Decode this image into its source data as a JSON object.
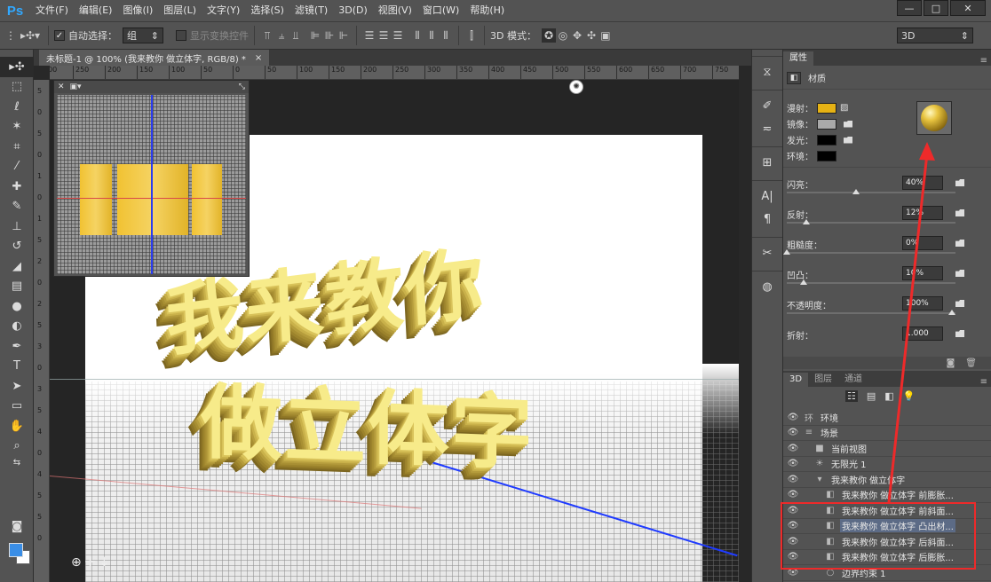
{
  "app": {
    "logo": "Ps",
    "menu": [
      "文件(F)",
      "编辑(E)",
      "图像(I)",
      "图层(L)",
      "文字(Y)",
      "选择(S)",
      "滤镜(T)",
      "3D(D)",
      "视图(V)",
      "窗口(W)",
      "帮助(H)"
    ],
    "window_controls": {
      "minimize": "—",
      "maximize": "□",
      "close": "✕"
    }
  },
  "options_bar": {
    "auto_select_label": "自动选择：",
    "auto_select_checked": true,
    "auto_select_value": "组",
    "show_transform_label": "显示变换控件",
    "mode_3d_label": "3D 模式：",
    "workspace_value": "3D"
  },
  "document": {
    "tab_title": "未标题-1 @ 100% (我来教你 做立体字, RGB/8) *",
    "ruler_top_ticks": [
      "300",
      "250",
      "200",
      "150",
      "100",
      "50",
      "0",
      "50",
      "100",
      "150",
      "200",
      "250",
      "300",
      "350",
      "400",
      "450",
      "500",
      "550",
      "600",
      "650",
      "700",
      "750"
    ],
    "ruler_left_digits": [
      "5",
      "0",
      "5",
      "0",
      "1",
      "0",
      "1",
      "5",
      "2",
      "0",
      "2",
      "5",
      "3",
      "0",
      "3",
      "5",
      "4",
      "0",
      "4",
      "5",
      "5",
      "0"
    ],
    "text_line1": "我来教你",
    "text_line2": "做立体字"
  },
  "properties_panel": {
    "tab": "属性",
    "section": "材质",
    "materials": [
      {
        "label": "漫射：",
        "color": "#e6b214"
      },
      {
        "label": "镜像：",
        "color": "#a9a9a9"
      },
      {
        "label": "发光：",
        "color": "#000000"
      },
      {
        "label": "环境：",
        "color": "#000000"
      }
    ],
    "sliders": [
      {
        "label": "闪亮：",
        "value": "40%",
        "level": 0.42
      },
      {
        "label": "反射：",
        "value": "12%",
        "level": 0.12
      },
      {
        "label": "粗糙度：",
        "value": "0%",
        "level": 0.0
      },
      {
        "label": "凹凸：",
        "value": "10%",
        "level": 0.1
      },
      {
        "label": "不透明度：",
        "value": "100%",
        "level": 1.0
      },
      {
        "label": "折射：",
        "value": "1.000",
        "level": null
      }
    ]
  },
  "layers_panel": {
    "tabs": [
      "3D",
      "图层",
      "通道"
    ],
    "rows": [
      {
        "name": "环境",
        "icon": "环",
        "indent": 0,
        "selected": false
      },
      {
        "name": "场景",
        "icon": "≡",
        "indent": 0,
        "selected": false
      },
      {
        "name": "当前视图",
        "icon": "■",
        "indent": 1,
        "selected": false
      },
      {
        "name": "无限光 1",
        "icon": "☀",
        "indent": 1,
        "selected": false
      },
      {
        "name": "我来教你 做立体字",
        "icon": "▾",
        "indent": 1,
        "selected": false
      },
      {
        "name": "我来教你 做立体字 前膨胀...",
        "icon": "◧",
        "indent": 2,
        "selected": false
      },
      {
        "name": "我来教你 做立体字 前斜面...",
        "icon": "◧",
        "indent": 2,
        "selected": false
      },
      {
        "name": "我来教你 做立体字 凸出材...",
        "icon": "◧",
        "indent": 2,
        "selected": true
      },
      {
        "name": "我来教你 做立体字 后斜面...",
        "icon": "◧",
        "indent": 2,
        "selected": false
      },
      {
        "name": "我来教你 做立体字 后膨胀...",
        "icon": "◧",
        "indent": 2,
        "selected": false
      },
      {
        "name": "边界约束 1",
        "icon": "○",
        "indent": 2,
        "selected": false
      }
    ]
  },
  "colors": {
    "highlight_box": "#ee2a2a",
    "foreground": "#3a8ee6",
    "background": "#ffffff"
  }
}
